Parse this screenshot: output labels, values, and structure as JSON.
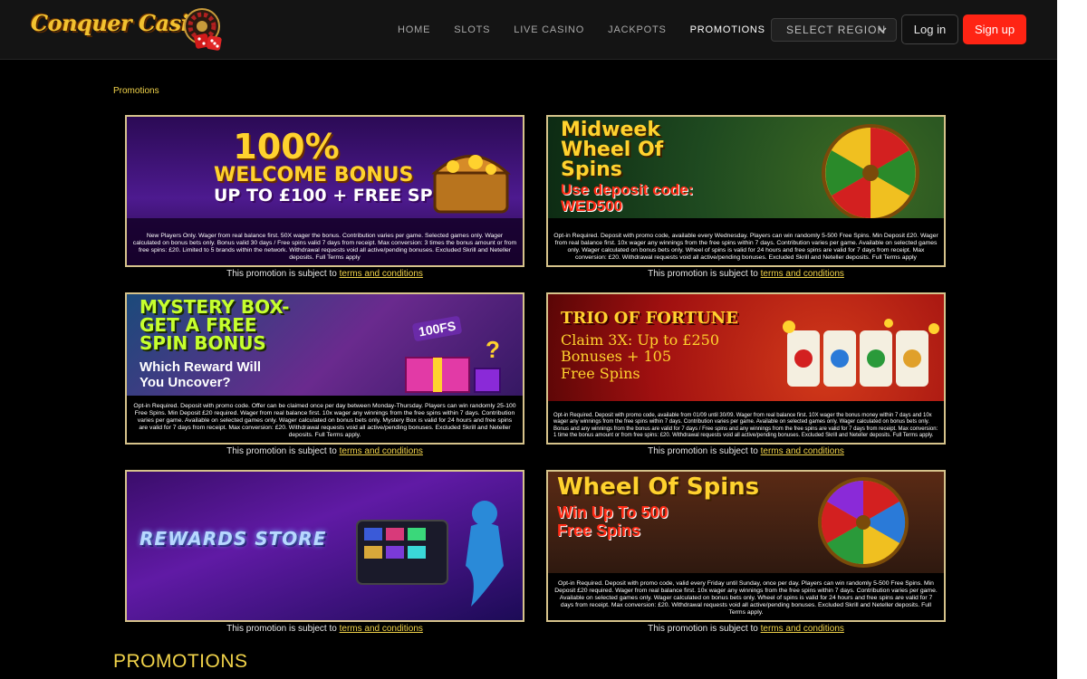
{
  "header": {
    "logo_text": "Conquer Casino",
    "nav": [
      {
        "label": "HOME"
      },
      {
        "label": "SLOTS"
      },
      {
        "label": "LIVE CASINO"
      },
      {
        "label": "JACKPOTS"
      },
      {
        "label": "PROMOTIONS",
        "active": true
      }
    ],
    "region_label": "SELECT REGION",
    "login_label": "Log in",
    "signup_label": "Sign up",
    "accent": "#ff2414"
  },
  "breadcrumb": "Promotions",
  "subject_prefix": "This promotion is subject to ",
  "subject_link": "terms and conditions",
  "promos": [
    {
      "title_lines": [
        "100%",
        "WELCOME BONUS",
        "UP TO £100 + FREE SPINS"
      ],
      "terms": "New Players Only. Wager from real balance first. 50X wager the bonus. Contribution varies per game. Selected games only. Wager calculated on bonus bets only. Bonus valid 30 days / Free spins valid 7 days from receipt. Max conversion: 3 times the bonus amount or from free spins: £20. Limited to 5 brands within the network. Withdrawal requests void all active/pending bonuses. Excluded Skrill and Neteller deposits. Full Terms apply"
    },
    {
      "title_lines": [
        "Midweek",
        "Wheel Of",
        "Spins"
      ],
      "code_label": "Use deposit code:",
      "code": "WED500",
      "terms": "Opt-in Required. Deposit with promo code, available every Wednesday. Players can win randomly 5-500 Free Spins. Min Deposit £20. Wager from real balance first. 10x wager any winnings from the free spins within 7 days. Contribution varies per game. Available on selected games only. Wager calculated on bonus bets only. Wheel of spins is valid for 24 hours and free spins are valid for 7 days from receipt. Max conversion: £20. Withdrawal requests void all active/pending bonuses. Excluded Skrill and Neteller deposits. Full Terms apply"
    },
    {
      "title_lines": [
        "MYSTERY BOX-",
        "GET A FREE",
        "SPIN BONUS"
      ],
      "subtitle_lines": [
        "Which Reward Will",
        "You Uncover?"
      ],
      "badge": "100FS",
      "terms": "Opt-in Required. Deposit with promo code. Offer can be claimed once per day between Monday-Thursday. Players can win randomly 25-100 Free Spins. Min Deposit £20 required. Wager from real balance first. 10x wager any winnings from the free spins within 7 days. Contribution varies per game. Available on selected games only. Wager calculated on bonus bets only. Mystery Box is valid for 24 hours and free spins are valid for 7 days from receipt. Max conversion: £20. Withdrawal requests void all active/pending bonuses. Excluded Skrill and Neteller deposits. Full Terms apply."
    },
    {
      "title_lines": [
        "TRIO OF FORTUNE"
      ],
      "subtitle_lines": [
        "Claim 3X: Up to £250",
        "Bonuses + 105",
        "Free Spins"
      ],
      "terms": "Opt-in Required. Deposit with promo code, available from 01/09 until 30/09. Wager from real balance first. 10X wager the bonus money within 7 days and 10x wager any winnings from the free spins within 7 days. Contribution varies per game. Available on selected games only. Wager calculated on bonus bets only. Bonus and any winnings from the bonus are valid for 7 days / Free spins and any winnings from the free spins are valid for 7 days from receipt. Max conversion: 1 time the bonus amount or from free spins: £20. Withdrawal requests void all active/pending bonuses. Excluded Skrill and Neteller deposits. Full Terms apply."
    },
    {
      "title_lines": [
        "REWARDS STORE"
      ],
      "terms": ""
    },
    {
      "title_lines": [
        "Wheel Of Spins"
      ],
      "subtitle_lines": [
        "Win Up To 500",
        "Free Spins"
      ],
      "terms": "Opt-in Required. Deposit with promo code, valid every Friday until Sunday, once per day. Players can win randomly 5-500 Free Spins. Min Deposit £20 required. Wager from real balance first. 10x wager any winnings from the free spins within 7 days. Contribution varies per game. Available on selected games only. Wager calculated on bonus bets only. Wheel of spins is valid for 24 hours and free spins are valid for 7 days from receipt. Max conversion: £20. Withdrawal requests void all active/pending bonuses. Excluded Skrill and Neteller deposits. Full Terms apply."
    }
  ],
  "promotions_heading": "PROMOTIONS"
}
